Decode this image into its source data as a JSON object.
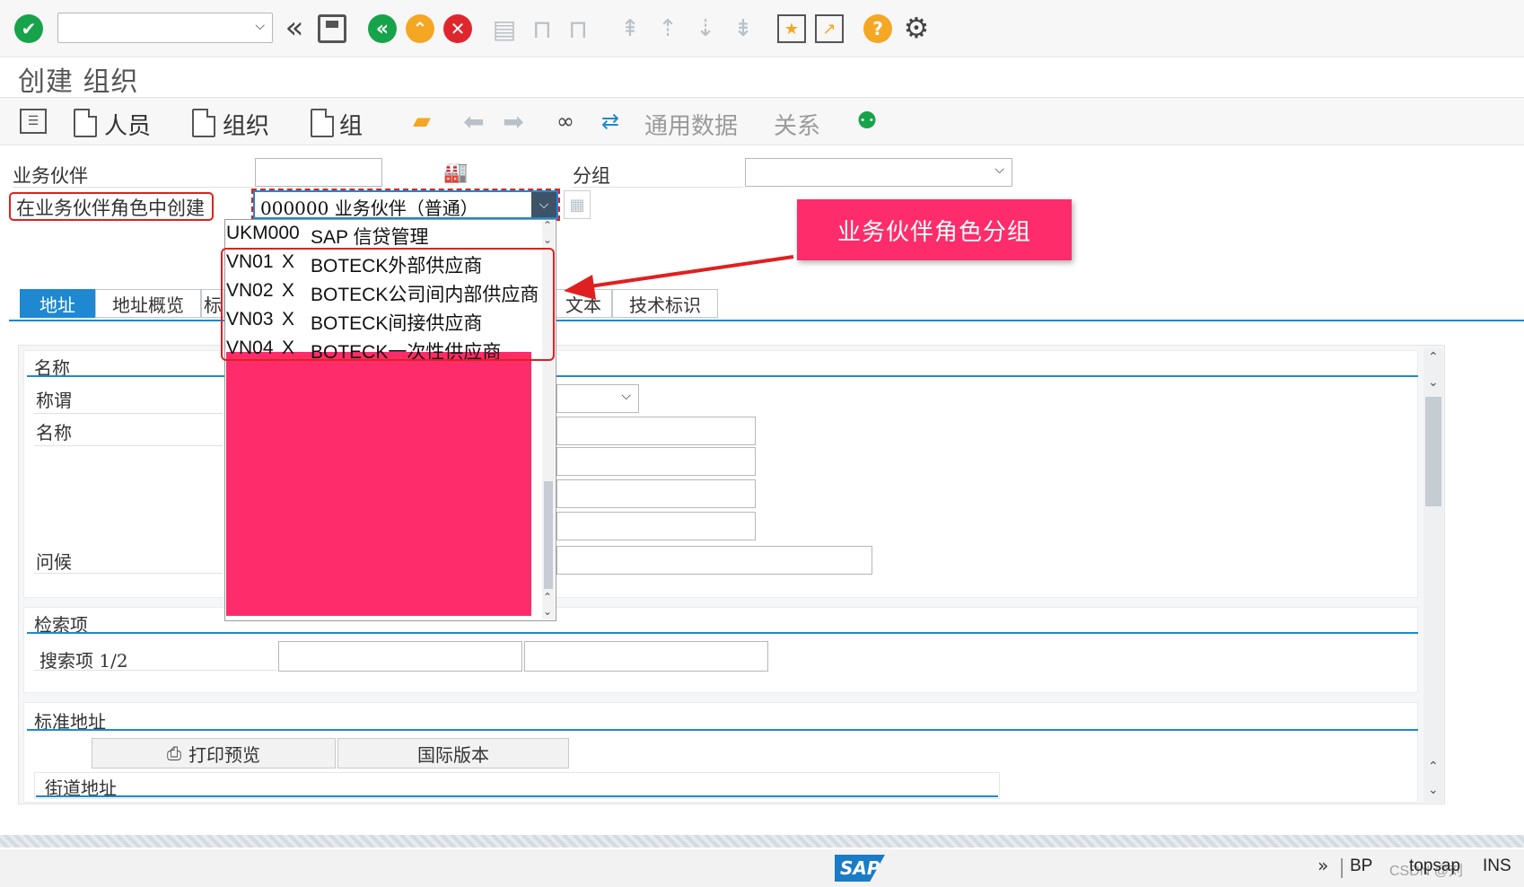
{
  "page_title": "创建 组织",
  "app_toolbar": {
    "person_label": "人员",
    "org_label": "组织",
    "group_label": "组",
    "general_data_label": "通用数据",
    "relations_label": "关系"
  },
  "form": {
    "business_partner_label": "业务伙伴",
    "grouping_label": "分组",
    "create_in_role_label": "在业务伙伴角色中创建",
    "role_value": "000000 业务伙伴（普通）"
  },
  "dropdown": {
    "options": [
      {
        "code": "UKM000",
        "flag": "",
        "text": "SAP 信贷管理"
      },
      {
        "code": "VN01",
        "flag": "X",
        "text": "BOTECK外部供应商"
      },
      {
        "code": "VN02",
        "flag": "X",
        "text": "BOTECK公司间内部供应商"
      },
      {
        "code": "VN03",
        "flag": "X",
        "text": "BOTECK间接供应商"
      },
      {
        "code": "VN04",
        "flag": "X",
        "text": "BOTECK一次性供应商"
      }
    ]
  },
  "callout": {
    "text": "业务伙伴角色分组"
  },
  "tabs": [
    {
      "label": "地址"
    },
    {
      "label": "地址概览"
    },
    {
      "label": "标"
    },
    {
      "label": "文本"
    },
    {
      "label": "技术标识"
    }
  ],
  "sections": {
    "name_title": "名称",
    "title_label": "称谓",
    "name_label": "名称",
    "greeting_label": "问候",
    "search_title": "检索项",
    "search_label": "搜索项 1/2",
    "std_address_title": "标准地址",
    "print_preview_label": "打印预览",
    "intl_version_label": "国际版本",
    "street_address_label": "街道地址"
  },
  "status_bar": {
    "logo_text": "SAP",
    "chevrons": "»",
    "transaction": "BP",
    "watermark": "CSDN @刘",
    "system": "topsap",
    "mode": "INS"
  },
  "colors": {
    "accent": "#1e88d0",
    "callout": "#fe2c6a",
    "highlight_border": "#e02020",
    "confirm_green": "#16a34a"
  }
}
